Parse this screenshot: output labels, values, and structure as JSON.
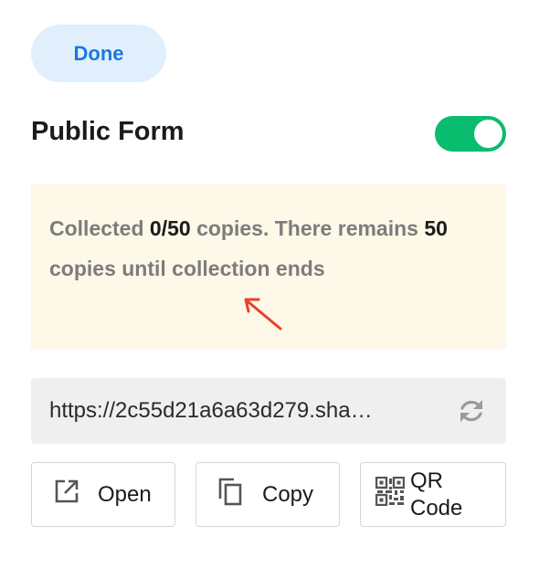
{
  "header": {
    "done_label": "Done",
    "title": "Public Form",
    "toggle_on": true
  },
  "notice": {
    "part1": "Collected ",
    "collected": "0/50",
    "part2": " copies. There remains ",
    "remaining": "50",
    "part3": " copies until collection ends"
  },
  "link": {
    "url": "https://2c55d21a6a63d279.sha…",
    "refresh_icon": "refresh-icon"
  },
  "actions": {
    "open_label": "Open",
    "copy_label": "Copy",
    "qr_label": "QR Code"
  },
  "colors": {
    "accent_blue": "#1a78e0",
    "done_bg": "#e1effc",
    "toggle_green": "#0abc6e",
    "notice_bg": "#fef8e8",
    "arrow_red": "#e8412c"
  }
}
